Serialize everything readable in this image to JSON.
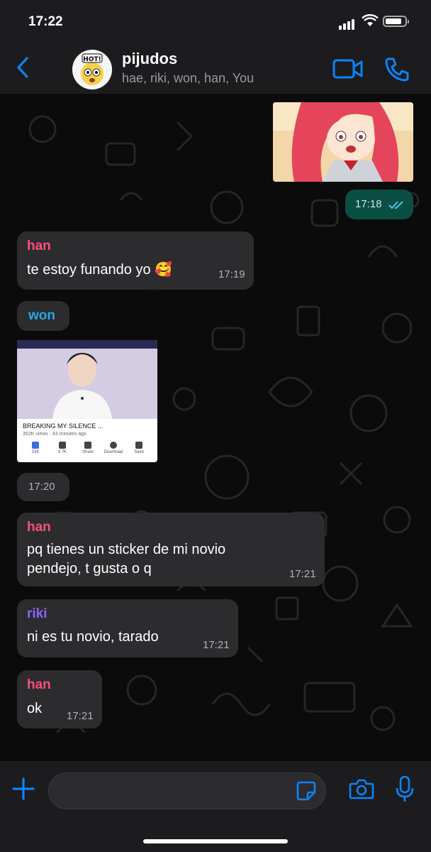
{
  "status_bar": {
    "time": "17:22"
  },
  "header": {
    "group_name": "pijudos",
    "members": "hae, riki, won, han, You",
    "avatar_label": "HOT!"
  },
  "colors": {
    "accent": "#0a84ff",
    "han": "#ff4f7b",
    "won": "#29a8e8",
    "riki": "#8c63ff",
    "outgoing": "#0b4f44"
  },
  "messages": [
    {
      "type": "image_outgoing",
      "time": "17:18",
      "status": "read"
    },
    {
      "sender": "han",
      "text": "te estoy funando yo 🥰",
      "time": "17:19"
    },
    {
      "sender": "won",
      "type": "youtube_sticker",
      "video_title": "BREAKING MY SILENCE ...",
      "video_meta": "352K views · 43 minutes ago",
      "actions": [
        "33K",
        "4.7K",
        "Share",
        "Download",
        "Save"
      ],
      "time": "17:20"
    },
    {
      "sender": "han",
      "text_line1": "pq tienes un sticker de mi novio",
      "text_line2": "pendejo, t gusta o q",
      "time": "17:21"
    },
    {
      "sender": "riki",
      "text": "ni es tu novio, tarado",
      "time": "17:21"
    },
    {
      "sender": "han",
      "text": "ok",
      "time": "17:21"
    }
  ],
  "composer": {
    "placeholder": ""
  }
}
